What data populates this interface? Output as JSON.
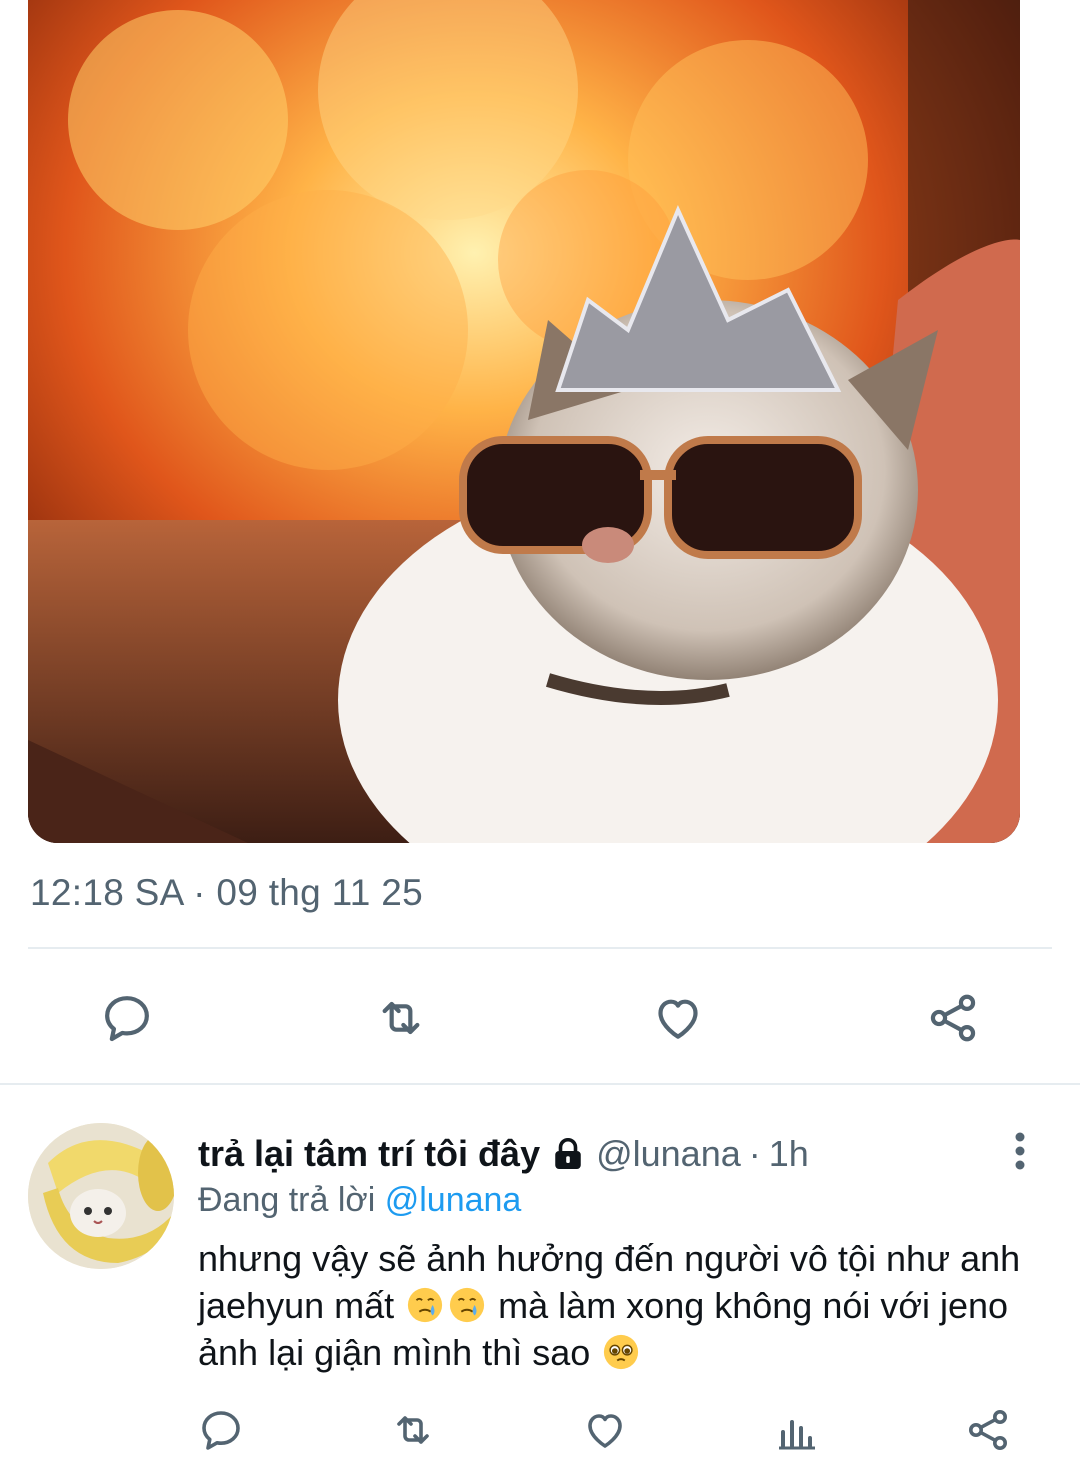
{
  "tweet": {
    "image_alt": "cat-wearing-tiara-and-sunglasses-in-front-of-fire",
    "timestamp": "12:18 SA · 09 thg 11 25",
    "actions": [
      "reply-icon",
      "retweet-icon",
      "like-icon",
      "share-icon"
    ]
  },
  "reply": {
    "display_name": "trả lại tâm trí tôi đây",
    "protected_icon": "lock-icon",
    "handle": "@lunana",
    "separator": "·",
    "time": "1h",
    "replying_prefix": "Đang trả lời",
    "replying_to": "@lunana",
    "text_part1": "nhưng vậy sẽ ảnh hưởng đến người vô tội như anh jaehyun mất",
    "text_part2": "mà làm xong không nói với jeno ảnh lại giận mình thì sao",
    "emojis": [
      "face-holding-back-tears-emoji",
      "face-holding-back-tears-emoji",
      "pleading-face-emoji"
    ],
    "actions": [
      "reply-icon",
      "retweet-icon",
      "like-icon",
      "analytics-icon",
      "share-icon"
    ]
  },
  "colors": {
    "text_primary": "#0f1419",
    "text_secondary": "#536471",
    "link": "#1d9bf0",
    "divider": "#e6ecf0"
  }
}
